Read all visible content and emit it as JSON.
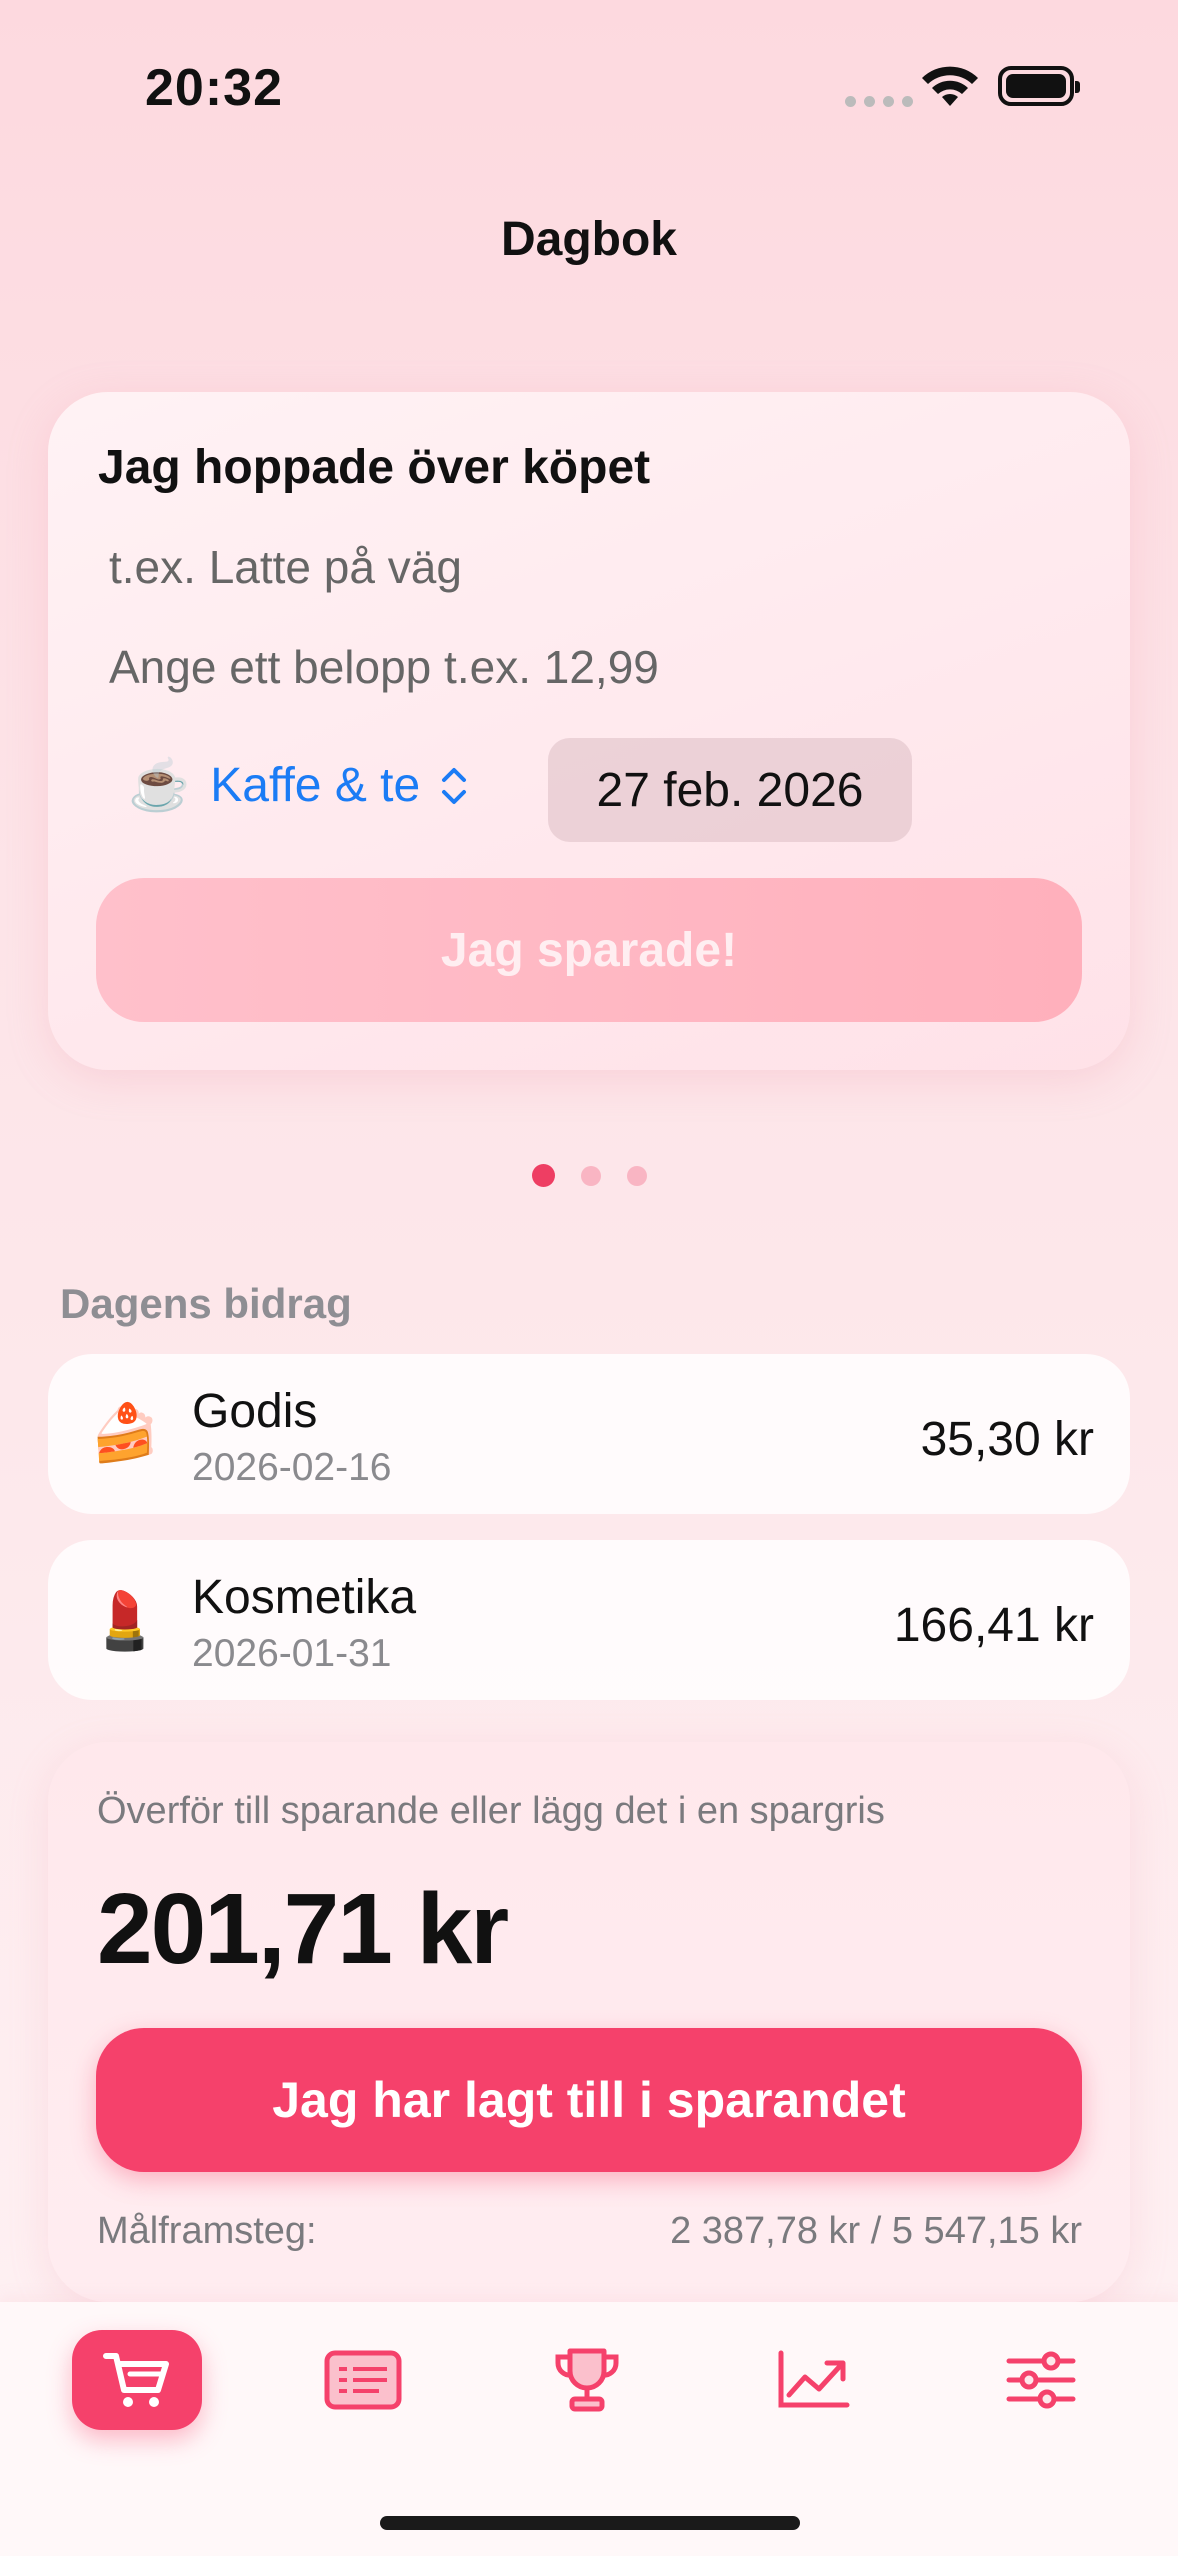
{
  "status_bar": {
    "time": "20:32"
  },
  "header": {
    "title": "Dagbok"
  },
  "entry_form": {
    "title": "Jag hoppade över köpet",
    "item_placeholder": "t.ex. Latte på väg",
    "amount_placeholder": "Ange ett belopp t.ex. 12,99",
    "category": {
      "emoji": "☕",
      "label": "Kaffe & te"
    },
    "date": "27 feb. 2026",
    "save_label": "Jag sparade!"
  },
  "pager": {
    "pages": 3,
    "active": 0
  },
  "contributions": {
    "section_title": "Dagens bidrag",
    "items": [
      {
        "emoji": "🍰",
        "name": "Godis",
        "date": "2026-02-16",
        "amount": "35,30 kr"
      },
      {
        "emoji": "💄",
        "name": "Kosmetika",
        "date": "2026-01-31",
        "amount": "166,41 kr"
      }
    ]
  },
  "transfer": {
    "hint": "Överför till sparande eller lägg det i en spargris",
    "total": "201,71 kr",
    "button_label": "Jag har lagt till i sparandet",
    "goal_label": "Målframsteg:",
    "goal_value": "2 387,78 kr / 5 547,15 kr"
  },
  "tabbar": {
    "accent": "#f5416b",
    "items": [
      {
        "icon": "cart-icon",
        "active": true
      },
      {
        "icon": "list-icon",
        "active": false
      },
      {
        "icon": "trophy-icon",
        "active": false
      },
      {
        "icon": "chart-icon",
        "active": false
      },
      {
        "icon": "sliders-icon",
        "active": false
      }
    ]
  }
}
